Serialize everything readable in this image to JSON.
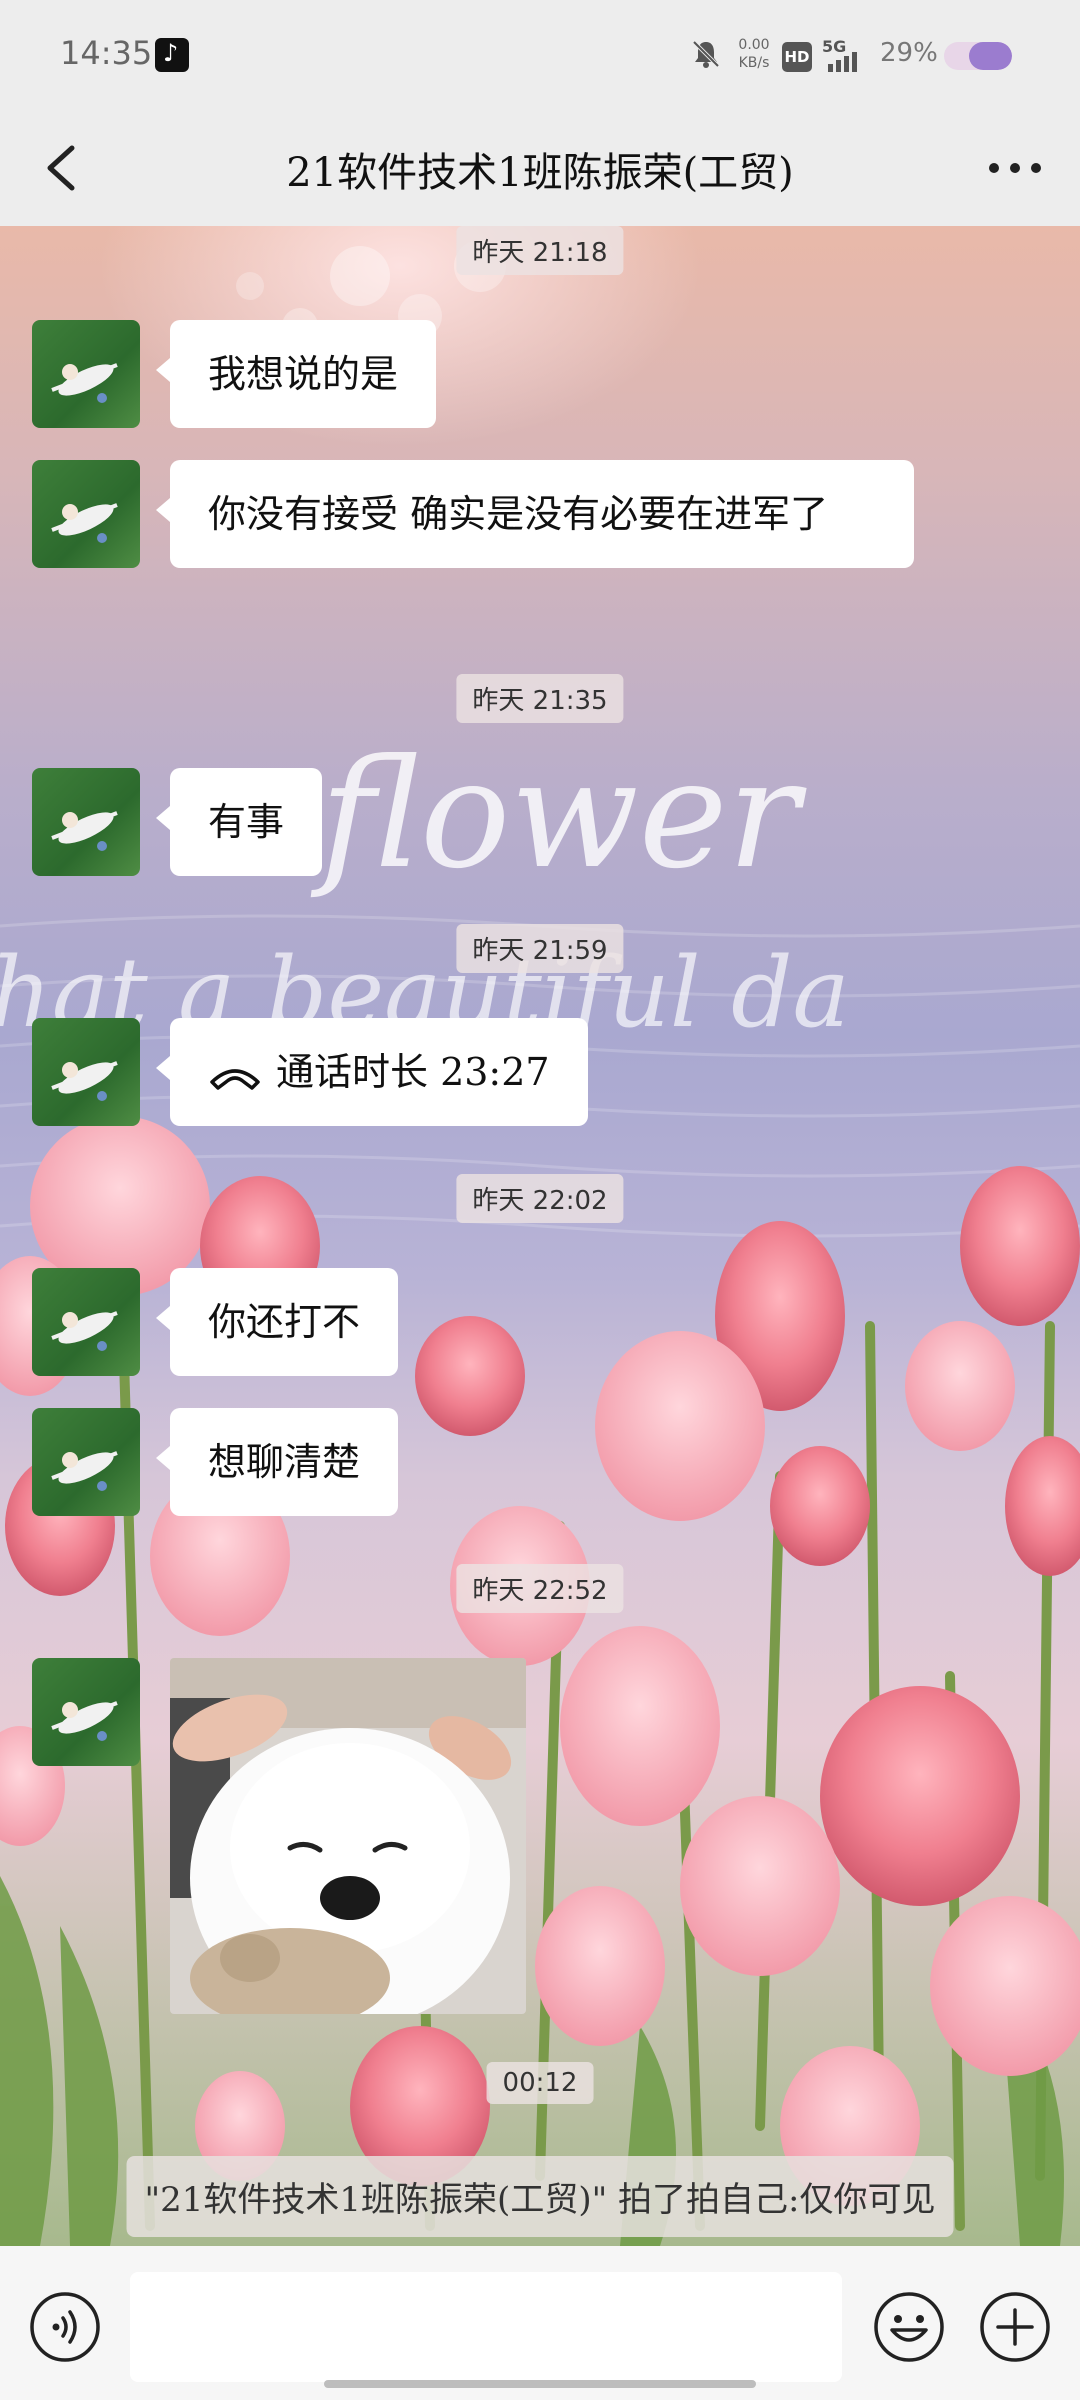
{
  "status_bar": {
    "time": "14:35",
    "net_speed_value": "0.00",
    "net_speed_unit": "KB/s",
    "hd_label": "HD",
    "network": "5G",
    "battery_percent": "29%",
    "battery_level": 0.29
  },
  "header": {
    "title": "21软件技术1班陈振荣(工贸)"
  },
  "background": {
    "script_text_1": "flower",
    "script_text_2": "hat a beautiful da"
  },
  "messages": [
    {
      "timestamp": "昨天 21:18"
    },
    {
      "text": "我想说的是"
    },
    {
      "text": "你没有接受 确实是没有必要在进军了"
    },
    {
      "timestamp": "昨天 21:35"
    },
    {
      "text": "有事"
    },
    {
      "timestamp": "昨天 21:59"
    },
    {
      "call_text": "通话时长 23:27"
    },
    {
      "timestamp": "昨天 22:02"
    },
    {
      "text": "你还打不"
    },
    {
      "text": "想聊清楚"
    },
    {
      "timestamp": "昨天 22:52"
    },
    {
      "image": "white-puppy-photo"
    },
    {
      "timestamp": "00:12"
    },
    {
      "system_note": "\"21软件技术1班陈振荣(工贸)\" 拍了拍自己:仅你可见"
    }
  ],
  "input_bar": {
    "placeholder": ""
  },
  "icons": {
    "back": "chevron-left-icon",
    "more": "more-dots-icon",
    "voice": "voice-icon",
    "emoji": "emoji-icon",
    "plus": "plus-icon",
    "call": "phone-call-icon"
  }
}
